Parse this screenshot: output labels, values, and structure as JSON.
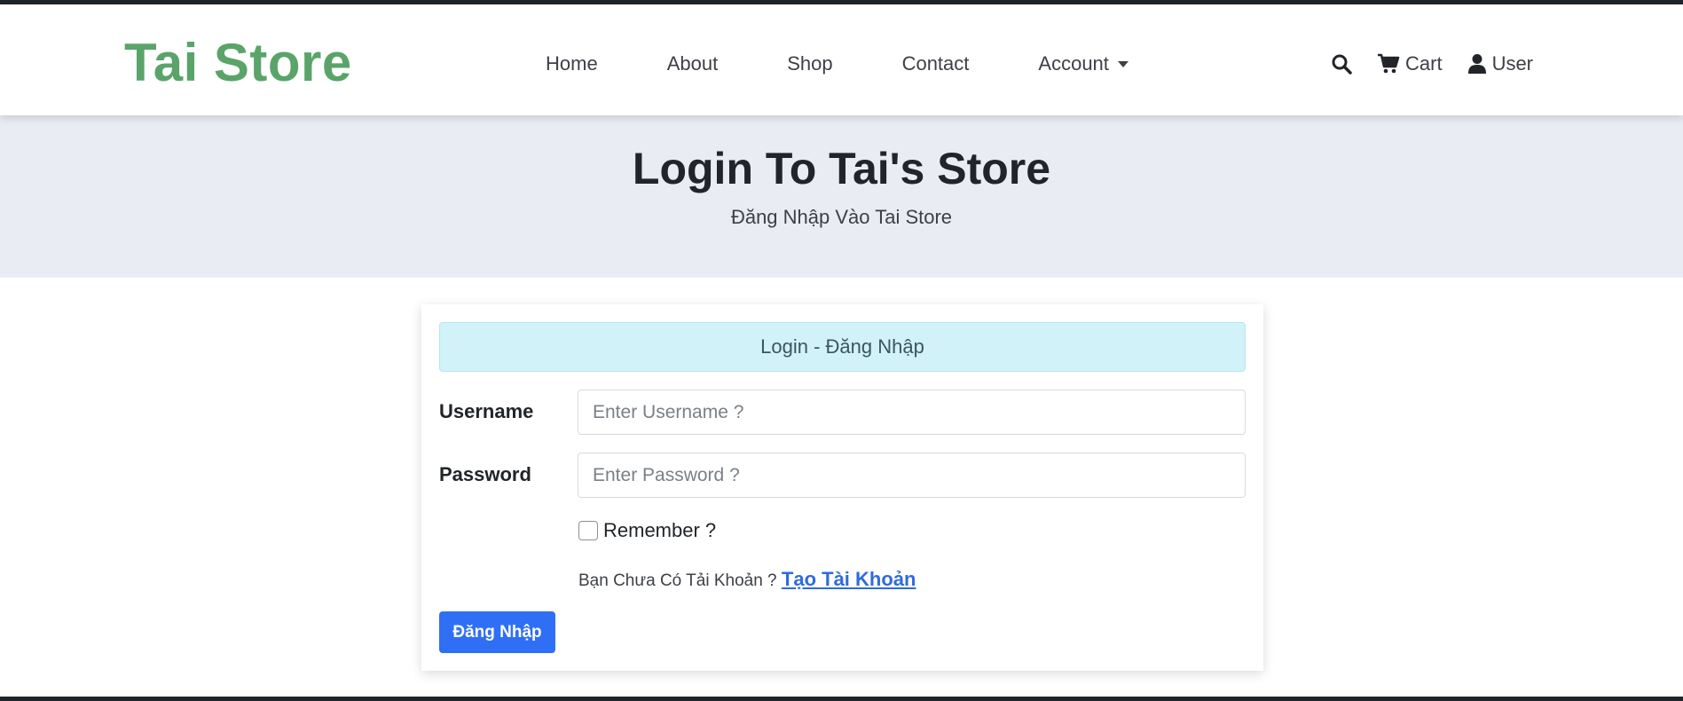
{
  "brand": {
    "name": "Tai Store",
    "color": "#5aa469"
  },
  "nav": {
    "links": [
      "Home",
      "About",
      "Shop",
      "Contact",
      "Account"
    ],
    "right": {
      "search_icon": "search-icon",
      "cart_label": "Cart",
      "user_label": "User"
    }
  },
  "hero": {
    "title": "Login To Tai's Store",
    "subtitle": "Đăng Nhập Vào Tai Store"
  },
  "form": {
    "alert_text": "Login - Đăng Nhập",
    "username_label": "Username",
    "username_placeholder": "Enter Username ?",
    "password_label": "Password",
    "password_placeholder": "Enter Password ?",
    "remember_label": "Remember ?",
    "no_account_text": "Bạn Chưa Có Tải Khoản ?",
    "create_account_link": "Tạo Tài Khoản",
    "submit_label": "Đăng Nhập"
  },
  "colors": {
    "accent": "#2f6ff5",
    "hero_bg": "#e9edf3",
    "alert_bg": "#d1f2f8",
    "link": "#2f6be0"
  }
}
